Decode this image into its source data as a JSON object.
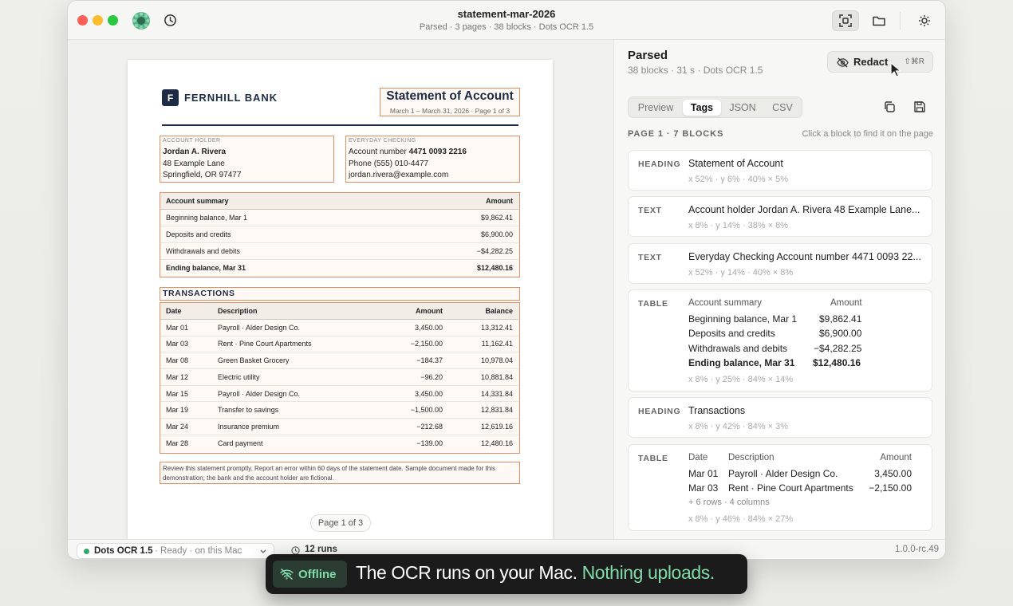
{
  "window": {
    "title": "statement-mar-2026",
    "subtitle": "Parsed · 3 pages · 38 blocks · Dots OCR 1.5"
  },
  "document": {
    "bank_name": "FERNHILL BANK",
    "logo_letter": "F",
    "title": "Statement of Account",
    "period": "March 1 – March 31, 2026 · Page 1 of 3",
    "holder": {
      "label": "ACCOUNT HOLDER",
      "name": "Jordan A. Rivera",
      "address1": "48 Example Lane",
      "address2": "Springfield, OR 97477"
    },
    "checking": {
      "label": "EVERYDAY CHECKING",
      "account_prefix": "Account number ",
      "account_number": "4471 0093 2216",
      "phone": "Phone (555) 010-4477",
      "email": "jordan.rivera@example.com"
    },
    "summary": {
      "header": [
        "Account summary",
        "Amount"
      ],
      "rows": [
        [
          "Beginning balance, Mar 1",
          "$9,862.41"
        ],
        [
          "Deposits and credits",
          "$6,900.00"
        ],
        [
          "Withdrawals and debits",
          "−$4,282.25"
        ]
      ],
      "total": [
        "Ending balance, Mar 31",
        "$12,480.16"
      ]
    },
    "transactions_title": "TRANSACTIONS",
    "transactions": {
      "header": [
        "Date",
        "Description",
        "Amount",
        "Balance"
      ],
      "rows": [
        [
          "Mar 01",
          "Payroll · Alder Design Co.",
          "3,450.00",
          "13,312.41"
        ],
        [
          "Mar 03",
          "Rent · Pine Court Apartments",
          "−2,150.00",
          "11,162.41"
        ],
        [
          "Mar 08",
          "Green Basket Grocery",
          "−184.37",
          "10,978.04"
        ],
        [
          "Mar 12",
          "Electric utility",
          "−96.20",
          "10,881.84"
        ],
        [
          "Mar 15",
          "Payroll · Alder Design Co.",
          "3,450.00",
          "14,331.84"
        ],
        [
          "Mar 19",
          "Transfer to savings",
          "−1,500.00",
          "12,831.84"
        ],
        [
          "Mar 24",
          "Insurance premium",
          "−212.68",
          "12,619.16"
        ],
        [
          "Mar 28",
          "Card payment",
          "−139.00",
          "12,480.16"
        ]
      ]
    },
    "footnote": "Review this statement promptly. Report an error within 60 days of the statement date. Sample document made for this demonstration; the bank and the account holder are fictional.",
    "page_indicator": "Page 1 of 3"
  },
  "panel": {
    "title": "Parsed",
    "subtitle": "38 blocks · 31 s · Dots OCR 1.5",
    "redact": {
      "label": "Redact",
      "shortcut": "⇧⌘R"
    },
    "tabs": [
      "Preview",
      "Tags",
      "JSON",
      "CSV"
    ],
    "active_tab": "Tags",
    "page_header": "PAGE 1 · 7 BLOCKS",
    "hint": "Click a block to find it on the page",
    "blocks": [
      {
        "tag": "HEADING",
        "text": "Statement of Account",
        "meta": "x 52% · y 6% · 40% × 5%"
      },
      {
        "tag": "TEXT",
        "text": "Account holder Jordan A. Rivera 48 Example Lane...",
        "meta": "x 8% · y 14% · 38% × 8%"
      },
      {
        "tag": "TEXT",
        "text": "Everyday Checking Account number 4471 0093 22...",
        "meta": "x 52% · y 14% · 40% × 8%"
      },
      {
        "tag": "TABLE",
        "meta": "x 8% · y 25% · 84% × 14%",
        "rows": [
          [
            "Account summary",
            "Amount"
          ],
          [
            "Beginning balance, Mar 1",
            "$9,862.41"
          ],
          [
            "Deposits and credits",
            "$6,900.00"
          ],
          [
            "Withdrawals and debits",
            "−$4,282.25"
          ],
          [
            "Ending balance, Mar 31",
            "$12,480.16"
          ]
        ]
      },
      {
        "tag": "HEADING",
        "text": "Transactions",
        "meta": "x 8% · y 42% · 84% × 3%"
      },
      {
        "tag": "TABLE",
        "meta": "x 8% · y 46% · 84% × 27%",
        "rows": [
          [
            "Date",
            "Description",
            "Amount"
          ],
          [
            "Mar 01",
            "Payroll · Alder Design Co.",
            "3,450.00"
          ],
          [
            "Mar 03",
            "Rent · Pine Court Apartments",
            "−2,150.00"
          ]
        ],
        "more": "+ 6 rows · 4 columns"
      }
    ]
  },
  "status": {
    "engine": "Dots OCR 1.5",
    "engine_state": "· Ready · on this Mac",
    "runs": "12 runs",
    "version": "1.0.0-rc.49"
  },
  "banner": {
    "badge": "Offline",
    "message": "The OCR runs on your Mac. ",
    "accent": "Nothing uploads."
  },
  "colors": {
    "highlight": "#e88d62",
    "accent_green": "#7fdcaa",
    "navy": "#1d2b44"
  }
}
